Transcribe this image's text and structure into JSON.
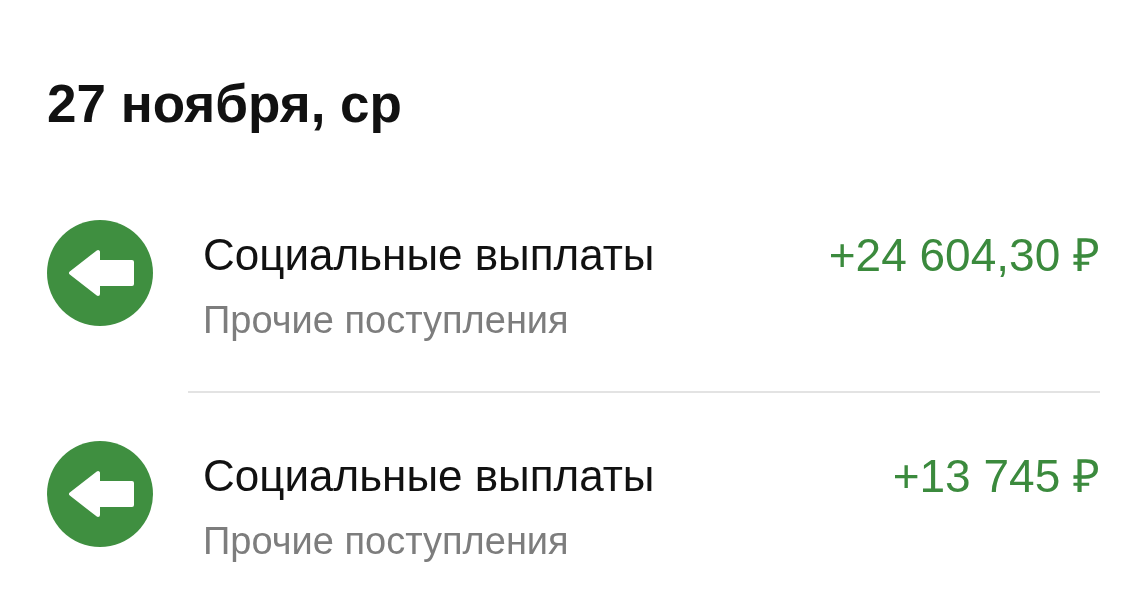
{
  "date_heading": "27 ноября, ср",
  "transactions": [
    {
      "kind": "incoming",
      "title": "Социальные выплаты",
      "category": "Прочие поступления",
      "amount": "+24 604,30 ₽"
    },
    {
      "kind": "incoming",
      "title": "Социальные выплаты",
      "category": "Прочие поступления",
      "amount": "+13 745 ₽"
    }
  ]
}
